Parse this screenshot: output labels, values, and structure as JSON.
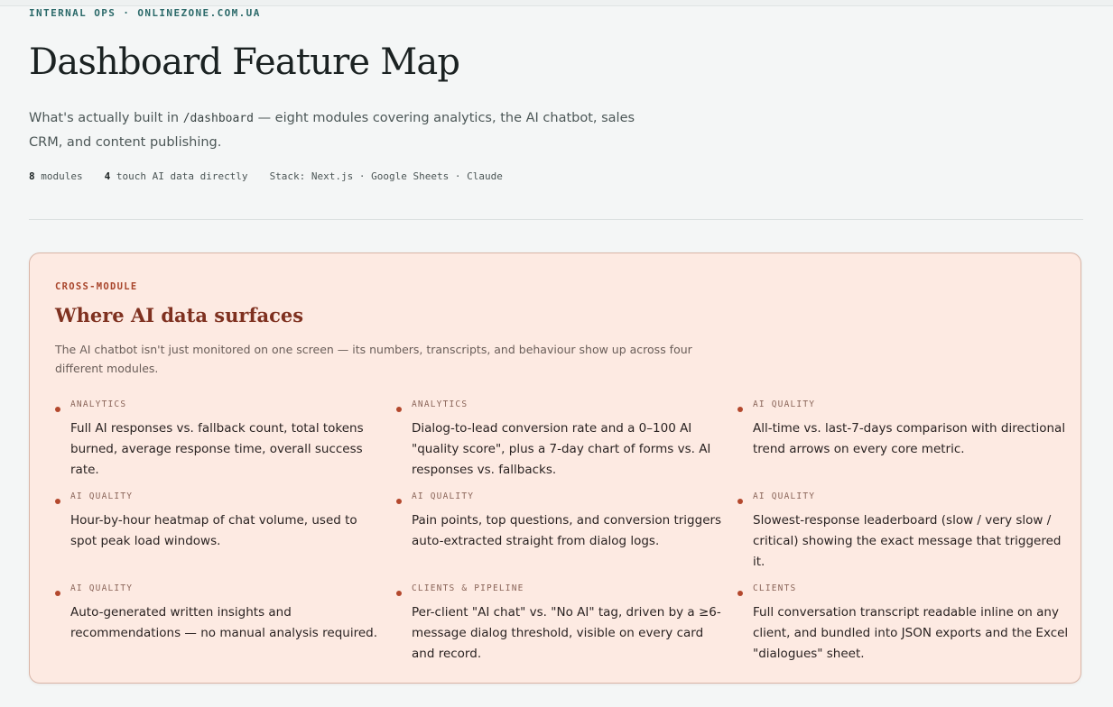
{
  "header": {
    "eyebrow": "INTERNAL OPS · ONLINEZONE.COM.UA",
    "title": "Dashboard Feature Map",
    "lede_before": "What's actually built in ",
    "lede_code": "/dashboard",
    "lede_after": " — eight modules covering analytics, the AI chatbot, sales CRM, and content publishing.",
    "stats": [
      {
        "value": "8",
        "label": " modules"
      },
      {
        "value": "4",
        "label": " touch AI data directly"
      },
      {
        "value": "",
        "label": "Stack: Next.js · Google Sheets · Claude"
      }
    ]
  },
  "cross_module": {
    "eyebrow": "CROSS-MODULE",
    "title": "Where AI data surfaces",
    "description": "The AI chatbot isn't just monitored on one screen — its numbers, transcripts, and behaviour show up across four different modules.",
    "items": [
      {
        "tag": "ANALYTICS",
        "text": "Full AI responses vs. fallback count, total tokens burned, average response time, overall success rate."
      },
      {
        "tag": "ANALYTICS",
        "text": "Dialog-to-lead conversion rate and a 0–100 AI \"quality score\", plus a 7-day chart of forms vs. AI responses vs. fallbacks."
      },
      {
        "tag": "AI QUALITY",
        "text": "All-time vs. last-7-days comparison with directional trend arrows on every core metric."
      },
      {
        "tag": "AI QUALITY",
        "text": "Hour-by-hour heatmap of chat volume, used to spot peak load windows."
      },
      {
        "tag": "AI QUALITY",
        "text": "Pain points, top questions, and conversion triggers auto-extracted straight from dialog logs."
      },
      {
        "tag": "AI QUALITY",
        "text": "Slowest-response leaderboard (slow / very slow / critical) showing the exact message that triggered it."
      },
      {
        "tag": "AI QUALITY",
        "text": "Auto-generated written insights and recommendations — no manual analysis required."
      },
      {
        "tag": "CLIENTS & PIPELINE",
        "text": "Per-client \"AI chat\" vs. \"No AI\" tag, driven by a ≥6-message dialog threshold, visible on every card and record."
      },
      {
        "tag": "CLIENTS",
        "text": "Full conversation transcript readable inline on any client, and bundled into JSON exports and the Excel \"dialogues\" sheet."
      }
    ]
  },
  "colors": {
    "background": "#f4f6f6",
    "accent": "#2c6a6a",
    "card_background": "#fdeae2",
    "card_accent": "#a8452b",
    "card_title": "#7f3120"
  }
}
